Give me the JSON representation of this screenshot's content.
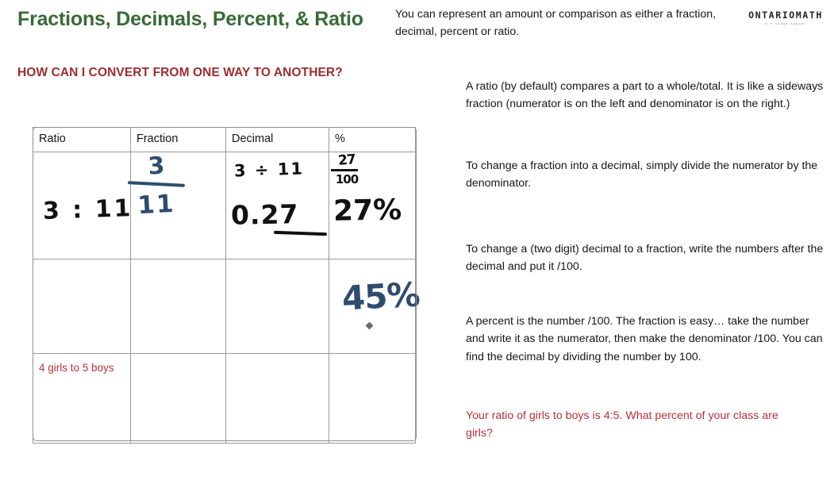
{
  "slide": {
    "title": "Fractions, Decimals, Percent, & Ratio",
    "subtitle": "HOW CAN I CONVERT FROM ONE WAY TO ANOTHER?",
    "intro": "You can represent an amount or comparison as either a fraction, decimal, percent or ratio."
  },
  "logo": {
    "word": "ONTARIOMATH",
    "tagline": "a t snapp sappar"
  },
  "table": {
    "headers": {
      "ratio": "Ratio",
      "fraction": "Fraction",
      "decimal": "Decimal",
      "percent": "%"
    },
    "row1": {
      "ratio": "3 : 11",
      "fraction_numerator": "3",
      "fraction_denominator": "11",
      "decimal_work": "3 ÷ 11",
      "decimal_value": "0.27",
      "percent_fraction_numerator": "27",
      "percent_fraction_denominator": "100",
      "percent_value": "27%"
    },
    "row2": {
      "ratio": "",
      "fraction": "",
      "decimal": "",
      "percent_value": "45%"
    },
    "row3": {
      "ratio": "4 girls to 5 boys",
      "fraction": "",
      "decimal": "",
      "percent": ""
    }
  },
  "notes": {
    "ratio_def": "A ratio (by default) compares a part to a whole/total. It is like a sideways fraction (numerator is on the left and denominator is on the right.)",
    "fraction_to_decimal": "To change a fraction into a decimal, simply divide the numerator by the denominator.",
    "decimal_to_fraction": "To change a (two digit) decimal to a fraction, write the numbers after the decimal and put it /100.",
    "percent_def": "A percent is the number /100.  The fraction is easy… take the number and write it as the numerator, then make the denominator /100.  You can find the decimal by dividing the number by 100.",
    "question": "Your ratio of girls to boys is 4:5.  What percent of your class are girls?"
  },
  "colors": {
    "title_green": "#386b37",
    "subtitle_red": "#9d2c31",
    "note_red": "#bf2f36",
    "ink_black": "#111111",
    "ink_blue": "#2f4c70"
  }
}
